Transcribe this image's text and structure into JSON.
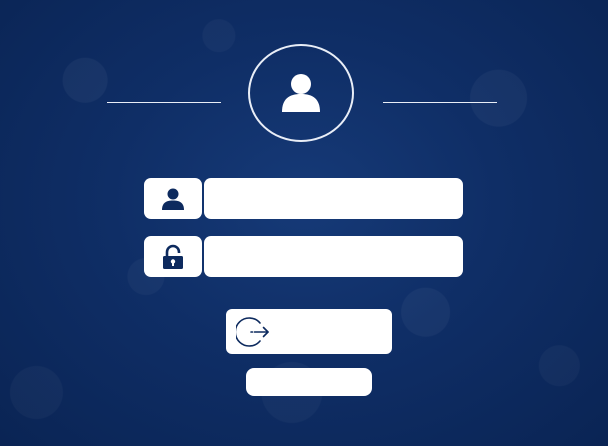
{
  "theme": {
    "background": "#0d2a5e",
    "panel": "#ffffff",
    "icon_color": "#0d2a5e",
    "line_color": "#e9eef7"
  },
  "header": {
    "avatar_icon": "user-icon"
  },
  "form": {
    "username": {
      "icon": "user-icon",
      "value": "",
      "placeholder": ""
    },
    "password": {
      "icon": "lock-icon",
      "value": "",
      "placeholder": ""
    },
    "login_button": {
      "icon": "sign-in-icon",
      "label": ""
    },
    "secondary_button": {
      "label": ""
    }
  }
}
